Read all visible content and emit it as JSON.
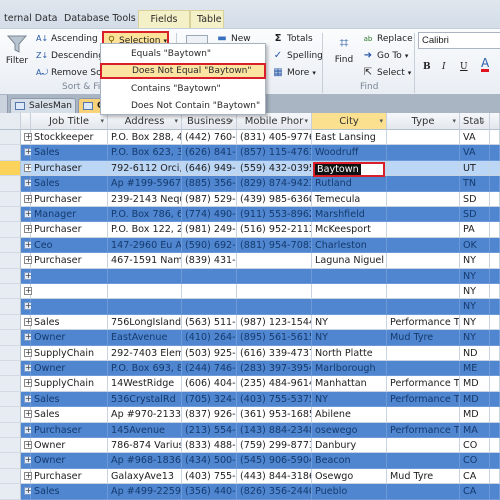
{
  "ribbon": {
    "tabs": [
      {
        "label": "ternal Data",
        "contextual": false
      },
      {
        "label": "Database Tools",
        "contextual": false
      },
      {
        "label": "Fields",
        "contextual": true
      },
      {
        "label": "Table",
        "contextual": true
      }
    ],
    "sort_filter": {
      "filter_label": "Filter",
      "ascending_label": "Ascending",
      "descending_label": "Descending",
      "remove_sort_label": "Remove Sort",
      "selection_label": "Selection",
      "group_label": "Sort & Filt"
    },
    "records": {
      "new_label": "New",
      "totals_label": "Totals",
      "spelling_label": "Spelling",
      "more_label": "More"
    },
    "find": {
      "find_label": "Find",
      "replace_label": "Replace",
      "goto_label": "Go To",
      "select_label": "Select",
      "group_label": "Find"
    },
    "text_formatting": {
      "font_name": "Calibri",
      "bold_label": "B",
      "italic_label": "I",
      "underline_label": "U",
      "font_color_label": "A",
      "font_color": "#e0141e"
    }
  },
  "selection_menu": {
    "items": [
      {
        "label": "Equals \"Baytown\"",
        "highlighted": false
      },
      {
        "label": "Does Not Equal \"Baytown\"",
        "highlighted": true
      },
      {
        "label": "Contains \"Baytown\"",
        "highlighted": false
      },
      {
        "label": "Does Not Contain \"Baytown\"",
        "highlighted": false
      }
    ]
  },
  "document_tabs": [
    {
      "label": "SalesMan",
      "active": false
    },
    {
      "label": "C",
      "active": true
    }
  ],
  "table": {
    "columns": [
      "Job Title",
      "Address",
      "Business",
      "Mobile Phor",
      "City",
      "Type",
      "Stat"
    ],
    "active_column": "City",
    "editing_value": "Baytown",
    "rows": [
      {
        "job": "Stockkeeper",
        "address": "P.O. Box 288, 4",
        "business": "(442) 760-4",
        "mobile": "(831) 405-9776",
        "city": "East Lansing",
        "type": "",
        "state": "VA"
      },
      {
        "job": "Sales",
        "address": "P.O. Box 623, 3",
        "business": "(626) 841-7",
        "mobile": "(857) 115-4761",
        "city": "Woodruff",
        "type": "",
        "state": "VA"
      },
      {
        "job": "Purchaser",
        "address": "792-6112 Orci, .",
        "business": "(646) 949-0",
        "mobile": "(559) 432-0395",
        "city": "Baytown",
        "type": "",
        "state": "UT"
      },
      {
        "job": "Sales",
        "address": "Ap #199-5967 C",
        "business": "(885) 356-3",
        "mobile": "(829) 874-9423",
        "city": "Rutland",
        "type": "",
        "state": "TN"
      },
      {
        "job": "Purchaser",
        "address": "239-2143 Nequ",
        "business": "(987) 529-8",
        "mobile": "(439) 985-6360",
        "city": "Temecula",
        "type": "",
        "state": "SD"
      },
      {
        "job": "Manager",
        "address": "P.O. Box 786, 6",
        "business": "(774) 490-1",
        "mobile": "(911) 553-8962",
        "city": "Marshfield",
        "type": "",
        "state": "SD"
      },
      {
        "job": "Purchaser",
        "address": "P.O. Box 122, 2",
        "business": "(981) 249-9",
        "mobile": "(516) 952-2113",
        "city": "McKeesport",
        "type": "",
        "state": "PA"
      },
      {
        "job": "Ceo",
        "address": "147-2960 Eu Av",
        "business": "(590) 692-1",
        "mobile": "(881) 954-7083",
        "city": "Charleston",
        "type": "",
        "state": "OK"
      },
      {
        "job": "Purchaser",
        "address": "467-1591 Nam .",
        "business": "(839) 431-7",
        "mobile": "",
        "city": "Laguna Niguel",
        "type": "",
        "state": "NY"
      },
      {
        "job": "",
        "address": "",
        "business": "",
        "mobile": "",
        "city": "",
        "type": "",
        "state": "NY"
      },
      {
        "job": "",
        "address": "",
        "business": "",
        "mobile": "",
        "city": "",
        "type": "",
        "state": "NY"
      },
      {
        "job": "",
        "address": "",
        "business": "",
        "mobile": "",
        "city": "",
        "type": "",
        "state": "NY"
      },
      {
        "job": "Sales",
        "address": "756LongIsland",
        "business": "(563) 511-5",
        "mobile": "(987) 123-1544",
        "city": "NY",
        "type": "Performance T",
        "state": "NY"
      },
      {
        "job": "Owner",
        "address": "EastAvenue",
        "business": "(410) 264-9",
        "mobile": "(895) 561-5615",
        "city": "NY",
        "type": "Mud Tyre",
        "state": "NY"
      },
      {
        "job": "SupplyChain",
        "address": "292-7403 Elem",
        "business": "(503) 925-3",
        "mobile": "(616) 339-4737",
        "city": "North Platte",
        "type": "",
        "state": "ND"
      },
      {
        "job": "Owner",
        "address": "P.O. Box 693, 8",
        "business": "(244) 746-2",
        "mobile": "(283) 397-3954",
        "city": "Marlborough",
        "type": "",
        "state": "ME"
      },
      {
        "job": "SupplyChain",
        "address": "14WestRidge",
        "business": "(606) 404-6",
        "mobile": "(235) 484-9614",
        "city": "Manhattan",
        "type": "Performance T",
        "state": "MD"
      },
      {
        "job": "Sales",
        "address": "536CrystalRd",
        "business": "(705) 324-6",
        "mobile": "(403) 755-5375",
        "city": "NY",
        "type": "Performance T",
        "state": "MD"
      },
      {
        "job": "Sales",
        "address": "Ap #970-2133 V",
        "business": "(837) 926-4",
        "mobile": "(361) 953-1685",
        "city": "Abilene",
        "type": "",
        "state": "MD"
      },
      {
        "job": "Purchaser",
        "address": "145Avenue",
        "business": "(213) 554-5",
        "mobile": "(143) 884-2348",
        "city": "osewego",
        "type": "Performance T",
        "state": "MA"
      },
      {
        "job": "Owner",
        "address": "786-874 Varius",
        "business": "(833) 488-4",
        "mobile": "(759) 299-8773",
        "city": "Danbury",
        "type": "",
        "state": "CO"
      },
      {
        "job": "Owner",
        "address": "Ap #968-1836 C",
        "business": "(434) 500-0",
        "mobile": "(545) 906-5904",
        "city": "Beacon",
        "type": "",
        "state": "CO"
      },
      {
        "job": "Purchaser",
        "address": "GalaxyAve13",
        "business": "(403) 755-5",
        "mobile": "(443) 844-3186",
        "city": "Osewgo",
        "type": "Mud Tyre",
        "state": "CA"
      },
      {
        "job": "Sales",
        "address": "Ap #499-2259 L",
        "business": "(356) 440-2",
        "mobile": "(826) 356-2440",
        "city": "Pueblo",
        "type": "",
        "state": "CA"
      }
    ]
  },
  "colors": {
    "alt_row_blue": "#4f86cf",
    "selected_row": "#bcd6f5",
    "highlight_border": "#d9202a",
    "active_column_header": "#fbe08f"
  }
}
